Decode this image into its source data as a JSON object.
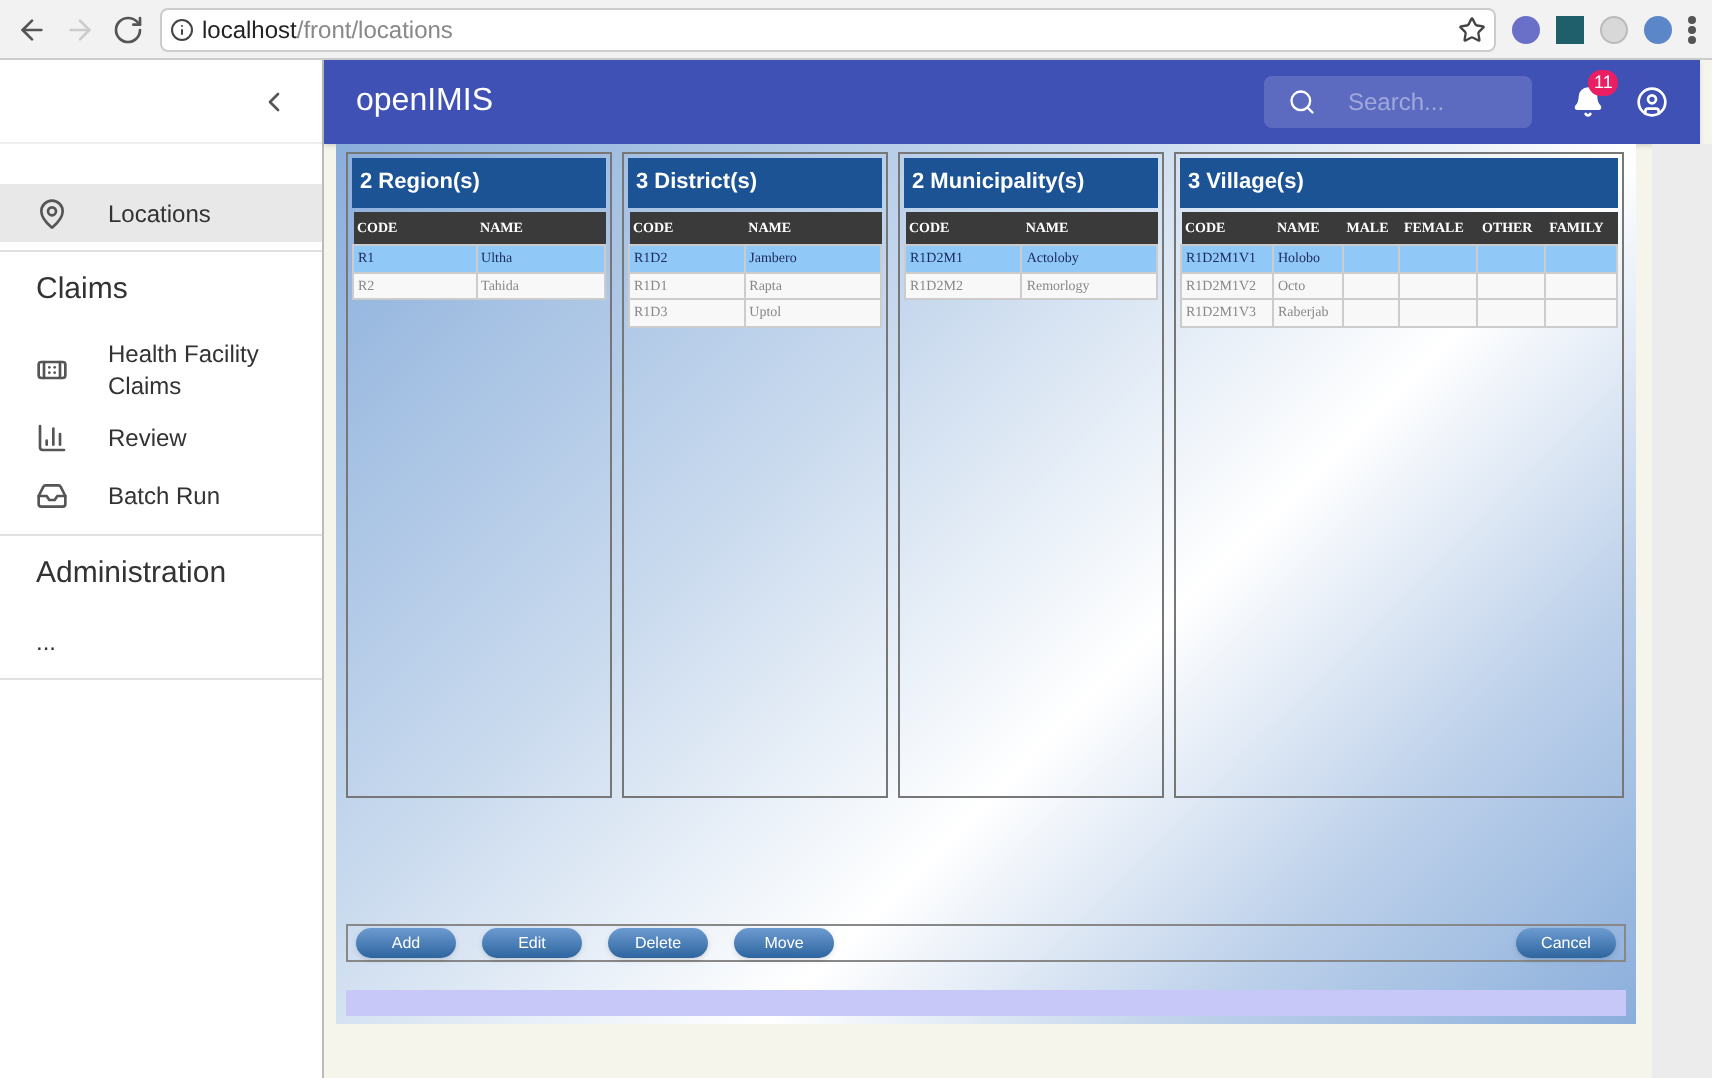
{
  "browser": {
    "url_host": "localhost",
    "url_path": "/front/locations",
    "forward_disabled": true
  },
  "sidebar": {
    "sections": [
      {
        "items": [
          {
            "kind": "pin",
            "label": "Locations",
            "selected": true
          }
        ]
      },
      {
        "header": "Claims",
        "items": [
          {
            "kind": "bandage",
            "label": "Health Facility Claims",
            "selected": false
          },
          {
            "kind": "chart",
            "label": "Review",
            "selected": false
          },
          {
            "kind": "batch",
            "label": "Batch Run",
            "selected": false
          }
        ]
      },
      {
        "header": "Administration",
        "items": [
          {
            "label": "...",
            "selected": false
          }
        ]
      }
    ]
  },
  "app_bar": {
    "title": "openIMIS",
    "search": {
      "placeholder": "Search..."
    },
    "notifications": "11"
  },
  "panels": [
    {
      "title": "2 Region(s)",
      "columns": [
        "CODE",
        "NAME"
      ],
      "rows": [
        {
          "selected": true,
          "cells": [
            "R1",
            "Ultha"
          ]
        },
        {
          "selected": false,
          "cells": [
            "R2",
            "Tahida"
          ]
        }
      ]
    },
    {
      "title": "3 District(s)",
      "columns": [
        "CODE",
        "NAME"
      ],
      "rows": [
        {
          "selected": true,
          "cells": [
            "R1D2",
            "Jambero"
          ]
        },
        {
          "selected": false,
          "cells": [
            "R1D1",
            "Rapta"
          ]
        },
        {
          "selected": false,
          "cells": [
            "R1D3",
            "Uptol"
          ]
        }
      ]
    },
    {
      "title": "2 Municipality(s)",
      "columns": [
        "CODE",
        "NAME"
      ],
      "rows": [
        {
          "selected": true,
          "cells": [
            "R1D2M1",
            "Actoloby"
          ]
        },
        {
          "selected": false,
          "cells": [
            "R1D2M2",
            "Remorlogy"
          ]
        }
      ]
    },
    {
      "title": "3 Village(s)",
      "columns": [
        "CODE",
        "NAME",
        "MALE",
        "FEMALE",
        "OTHER",
        "FAMILY"
      ],
      "rows": [
        {
          "selected": true,
          "cells": [
            "R1D2M1V1",
            "Holobo",
            "",
            "",
            "",
            ""
          ]
        },
        {
          "selected": false,
          "cells": [
            "R1D2M1V2",
            "Octo",
            "",
            "",
            "",
            ""
          ]
        },
        {
          "selected": false,
          "cells": [
            "R1D2M1V3",
            "Raberjab",
            "",
            "",
            "",
            ""
          ]
        }
      ]
    }
  ],
  "buttons": [
    "Add",
    "Edit",
    "Delete",
    "Move"
  ],
  "cancel_button": "Cancel"
}
